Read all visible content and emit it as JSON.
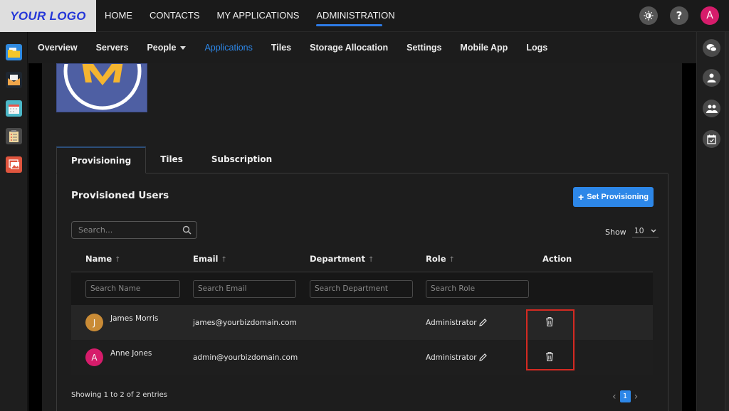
{
  "brand": {
    "logo_text": "YOUR LOGO"
  },
  "topnav": {
    "items": [
      {
        "label": "HOME"
      },
      {
        "label": "CONTACTS"
      },
      {
        "label": "MY APPLICATIONS"
      },
      {
        "label": "ADMINISTRATION",
        "active": true
      }
    ],
    "theme_icon": "brightness-icon",
    "help_label": "?",
    "user_initial": "A"
  },
  "subnav": {
    "items": [
      {
        "label": "Overview"
      },
      {
        "label": "Servers"
      },
      {
        "label": "People",
        "dropdown": true
      },
      {
        "label": "Applications",
        "active": true
      },
      {
        "label": "Tiles"
      },
      {
        "label": "Storage Allocation"
      },
      {
        "label": "Settings"
      },
      {
        "label": "Mobile App"
      },
      {
        "label": "Logs"
      }
    ]
  },
  "left_rail": {
    "apps": [
      {
        "name": "files-app-icon"
      },
      {
        "name": "mail-app-icon"
      },
      {
        "name": "calendar-app-icon"
      },
      {
        "name": "tasks-app-icon"
      },
      {
        "name": "photos-app-icon"
      }
    ]
  },
  "right_rail": {
    "items": [
      {
        "name": "chat-icon"
      },
      {
        "name": "user-icon"
      },
      {
        "name": "users-icon"
      },
      {
        "name": "calendar-check-icon"
      }
    ]
  },
  "tabs": [
    {
      "label": "Provisioning",
      "active": true
    },
    {
      "label": "Tiles"
    },
    {
      "label": "Subscription"
    }
  ],
  "provisioning": {
    "title": "Provisioned Users",
    "set_button_label": "Set Provisioning",
    "search_placeholder": "Search...",
    "show_label": "Show",
    "page_size": "10",
    "columns": [
      {
        "label": "Name",
        "sortable": true
      },
      {
        "label": "Email",
        "sortable": true
      },
      {
        "label": "Department",
        "sortable": true
      },
      {
        "label": "Role",
        "sortable": true
      },
      {
        "label": "Action",
        "sortable": false
      }
    ],
    "filters": {
      "name_placeholder": "Search Name",
      "email_placeholder": "Search Email",
      "department_placeholder": "Search Department",
      "role_placeholder": "Search Role"
    },
    "rows": [
      {
        "initial": "J",
        "avatar_color": "#c98b36",
        "name": "James Morris",
        "email": "james@yourbizdomain.com",
        "department": "",
        "role": "Administrator"
      },
      {
        "initial": "A",
        "avatar_color": "#d61c6b",
        "name": "Anne Jones",
        "email": "admin@yourbizdomain.com",
        "department": "",
        "role": "Administrator"
      }
    ],
    "footer_info": "Showing 1 to 2 of 2 entries",
    "current_page": "1"
  },
  "colors": {
    "accent": "#2d87e8",
    "highlight": "#d42a22"
  }
}
